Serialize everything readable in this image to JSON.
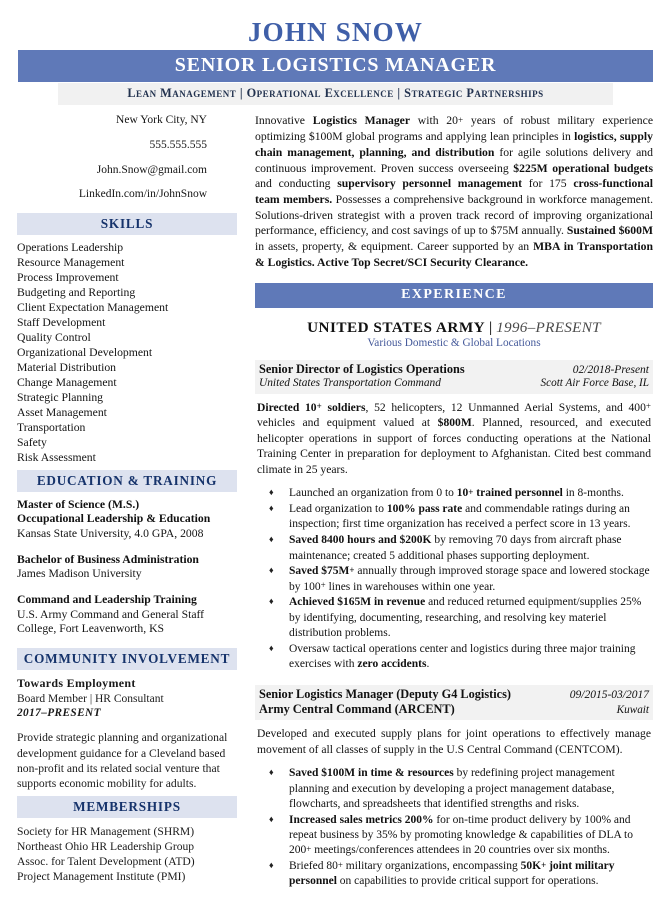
{
  "header": {
    "name": "JOHN SNOW",
    "title": "SENIOR LOGISTICS MANAGER",
    "tagline": "Lean Management | Operational Excellence | Strategic Partnerships",
    "banner_color": "#5f79b8",
    "name_color": "#3f5fa8",
    "tagline_bg": "#f1f1f1"
  },
  "contact": {
    "location": "New York City, NY",
    "phone": "555.555.555",
    "email": "John.Snow@gmail.com",
    "linkedin": "LinkedIn.com/in/JohnSnow"
  },
  "sections": {
    "skills_title": "SKILLS",
    "education_title": "EDUCATION & TRAINING",
    "community_title": "COMMUNITY INVOLVEMENT",
    "memberships_title": "MEMBERSHIPS",
    "experience_title": "EXPERIENCE",
    "side_bar_bg": "#dde2ef",
    "side_bar_color": "#16336b"
  },
  "skills": [
    "Operations Leadership",
    "Resource Management",
    "Process Improvement",
    "Budgeting and Reporting",
    "Client Expectation Management",
    "Staff Development",
    "Quality Control",
    "Organizational Development",
    "Material Distribution",
    "Change Management",
    "Strategic Planning",
    "Asset Management",
    "Transportation",
    "Safety",
    "Risk Assessment"
  ],
  "education": [
    {
      "degree_line1": "Master of Science (M.S.)",
      "degree_line2": "Occupational Leadership & Education",
      "school": "Kansas State University, 4.0 GPA, 2008"
    },
    {
      "degree_line1": "Bachelor of Business Administration",
      "degree_line2": "",
      "school": "James Madison University"
    },
    {
      "degree_line1": "Command and Leadership Training",
      "degree_line2": "",
      "school": "U.S. Army Command and General Staff College, Fort Leavenworth, KS"
    }
  ],
  "community": {
    "org": "Towards Employment",
    "role": "Board Member | HR Consultant",
    "dates": "2017–PRESENT",
    "description": "Provide strategic planning and organizational development guidance for a Cleveland based non-profit and its related social venture that supports economic mobility for adults."
  },
  "memberships": [
    "Society for HR Management (SHRM)",
    "Northeast Ohio HR Leadership Group",
    "Assoc. for Talent Development (ATD)",
    "Project Management Institute (PMI)"
  ],
  "summary": {
    "segments": [
      {
        "text": "Innovative ",
        "bold": false
      },
      {
        "text": "Logistics Manager",
        "bold": true
      },
      {
        "text": " with 20",
        "bold": false
      },
      {
        "text": "+",
        "bold": false,
        "sup": true
      },
      {
        "text": " years of robust military experience optimizing $100M global programs and applying lean principles in ",
        "bold": false
      },
      {
        "text": "logistics, supply chain management, planning, and distribution",
        "bold": true
      },
      {
        "text": " for agile solutions delivery and continuous improvement. Proven success overseeing ",
        "bold": false
      },
      {
        "text": "$225M operational budgets",
        "bold": true
      },
      {
        "text": " and conducting ",
        "bold": false
      },
      {
        "text": "supervisory personnel management",
        "bold": true
      },
      {
        "text": " for 175 ",
        "bold": false
      },
      {
        "text": "cross-functional team members.",
        "bold": true
      },
      {
        "text": " Possesses a comprehensive background in workforce management. Solutions-driven strategist with a proven track record of improving organizational performance, efficiency, and cost savings of up to $75M annually. ",
        "bold": false
      },
      {
        "text": "Sustained $600M",
        "bold": true
      },
      {
        "text": " in assets, property, & equipment. Career supported by an ",
        "bold": false
      },
      {
        "text": "MBA in Transportation & Logistics. Active Top Secret/SCI Security Clearance.",
        "bold": true
      }
    ]
  },
  "experience": {
    "company": "UNITED STATES ARMY",
    "separator": "|",
    "company_dates": "1996–PRESENT",
    "company_location": "Various Domestic & Global Locations",
    "company_location_color": "#44599a",
    "jobs": [
      {
        "title": "Senior Director of Logistics Operations",
        "date": "02/2018-Present",
        "org": "United States Transportation Command",
        "org_bold": false,
        "location": "Scott Air Force Base, IL",
        "description": [
          {
            "text": "Directed 10",
            "bold": true
          },
          {
            "text": "+",
            "bold": true,
            "sup": true
          },
          {
            "text": " soldiers",
            "bold": true
          },
          {
            "text": ", 52 helicopters, 12 Unmanned Aerial Systems, and 400",
            "bold": false
          },
          {
            "text": "+",
            "bold": false,
            "sup": true
          },
          {
            "text": " vehicles and equipment valued at ",
            "bold": false
          },
          {
            "text": "$800M",
            "bold": true
          },
          {
            "text": ". Planned, resourced, and executed helicopter operations in support of forces conducting operations at the National Training Center in preparation for deployment to Afghanistan. Cited best command climate in 25 years.",
            "bold": false
          }
        ],
        "bullets": [
          [
            {
              "text": "Launched an organization from 0 to ",
              "bold": false
            },
            {
              "text": "10",
              "bold": true
            },
            {
              "text": "+",
              "bold": true,
              "sup": true
            },
            {
              "text": " trained personnel",
              "bold": true
            },
            {
              "text": " in 8-months.",
              "bold": false
            }
          ],
          [
            {
              "text": "Lead organization to ",
              "bold": false
            },
            {
              "text": "100% pass rate",
              "bold": true
            },
            {
              "text": " and commendable ratings during an inspection; first time organization has received a perfect score in 13 years.",
              "bold": false
            }
          ],
          [
            {
              "text": "Saved 8400 hours and $200K",
              "bold": true
            },
            {
              "text": " by removing 70 days from aircraft phase maintenance; created 5 additional phases supporting deployment.",
              "bold": false
            }
          ],
          [
            {
              "text": "Saved $75M",
              "bold": true
            },
            {
              "text": "+",
              "bold": true,
              "sup": true
            },
            {
              "text": " annually through improved storage space and lowered stockage by 100",
              "bold": false
            },
            {
              "text": "+",
              "bold": false,
              "sup": true
            },
            {
              "text": " lines in warehouses within one year.",
              "bold": false
            }
          ],
          [
            {
              "text": "Achieved $165M in revenue",
              "bold": true
            },
            {
              "text": " and reduced returned equipment/supplies 25% by identifying, documenting, researching, and resolving key materiel distribution problems.",
              "bold": false
            }
          ],
          [
            {
              "text": "Oversaw tactical operations center and logistics during three major training exercises with ",
              "bold": false
            },
            {
              "text": "zero accidents",
              "bold": true
            },
            {
              "text": ".",
              "bold": false
            }
          ]
        ]
      },
      {
        "title": "Senior Logistics Manager (Deputy G4 Logistics)",
        "date": "09/2015-03/2017",
        "org": "Army Central Command (ARCENT)",
        "org_bold": true,
        "location": "Kuwait",
        "description": [
          {
            "text": "Developed and executed supply plans for joint operations to effectively manage movement of all classes of supply in the U.S Central Command (CENTCOM).",
            "bold": false
          }
        ],
        "bullets": [
          [
            {
              "text": "Saved $100M in time & resources",
              "bold": true
            },
            {
              "text": " by redefining project management planning and execution by developing a project management database, flowcharts, and spreadsheets that identified strengths and risks.",
              "bold": false
            }
          ],
          [
            {
              "text": "Increased sales metrics 200%",
              "bold": true
            },
            {
              "text": " for on-time product delivery by 100% and repeat business by 35% by promoting knowledge & capabilities of DLA to 200",
              "bold": false
            },
            {
              "text": "+",
              "bold": false,
              "sup": true
            },
            {
              "text": " meetings/conferences attendees in 20 countries over six months.",
              "bold": false
            }
          ],
          [
            {
              "text": "Briefed 80",
              "bold": false
            },
            {
              "text": "+",
              "bold": false,
              "sup": true
            },
            {
              "text": " military organizations, encompassing ",
              "bold": false
            },
            {
              "text": "50K",
              "bold": true
            },
            {
              "text": "+",
              "bold": true,
              "sup": true
            },
            {
              "text": " joint military personnel",
              "bold": true
            },
            {
              "text": " on capabilities to provide critical support for operations.",
              "bold": false
            }
          ]
        ]
      }
    ]
  }
}
